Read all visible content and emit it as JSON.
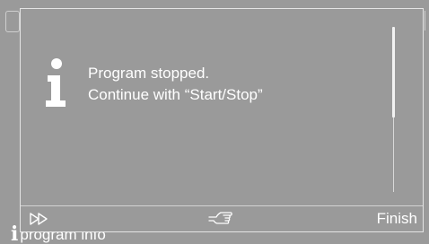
{
  "dialog": {
    "icon": "info-icon",
    "message_lines": [
      "Program stopped.",
      "Continue with “Start/Stop”"
    ],
    "scroll_position_fraction": 0.0,
    "scroll_visible_fraction": 0.55
  },
  "footer": {
    "forward_icon": "fast-forward-icon",
    "hand_icon": "pointing-hand-icon",
    "finish_label": "Finish"
  },
  "background": {
    "info_icon_glyph": "i",
    "info_label": "program info"
  },
  "colors": {
    "screen_bg": "#9a9a9a",
    "text": "#ffffff",
    "border": "#e4e4e4"
  }
}
